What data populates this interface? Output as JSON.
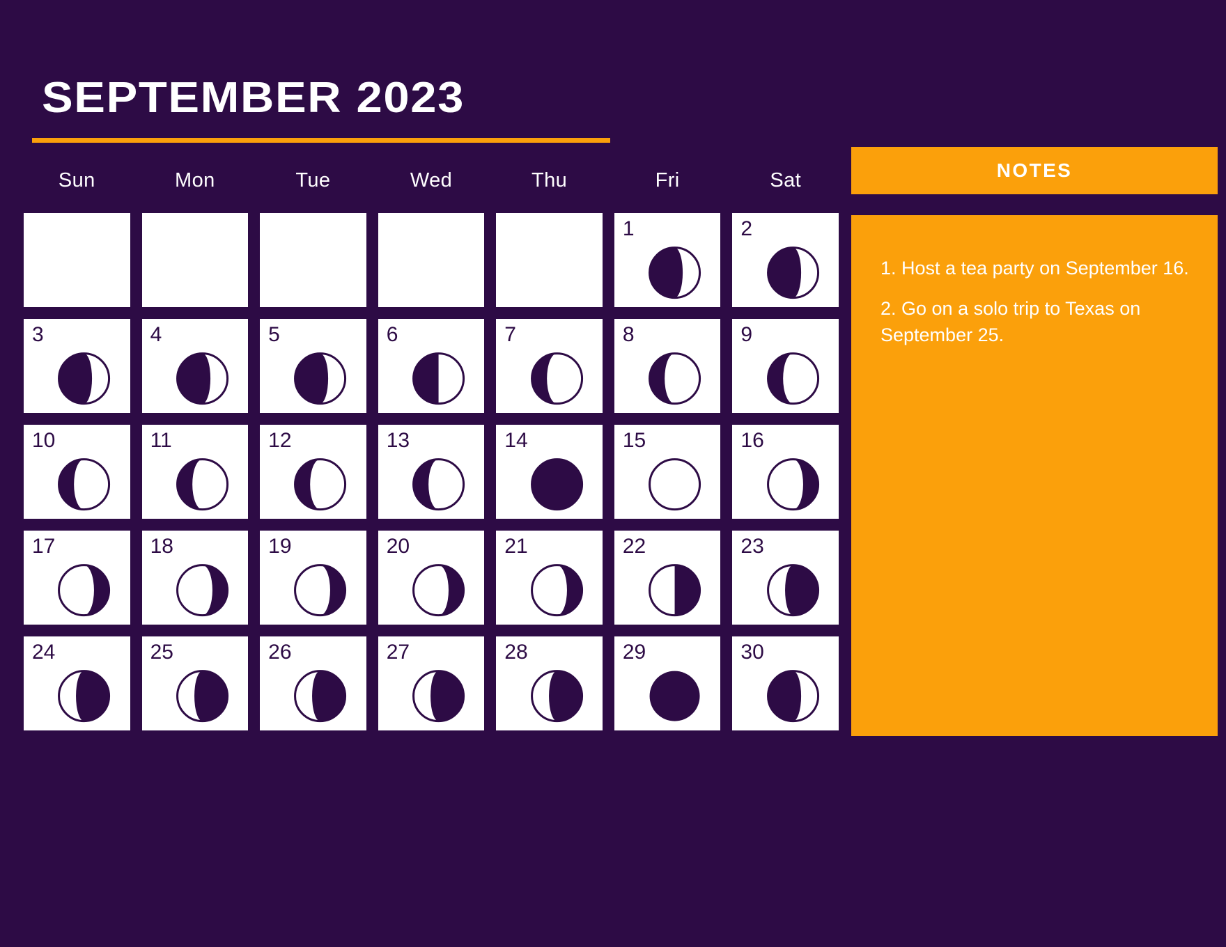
{
  "theme": {
    "background": "#2D0B45",
    "accent": "#FBA00B",
    "cell_bg": "#FFFFFF",
    "ink": "#2D0B45",
    "text_light": "#FFFFFF"
  },
  "header": {
    "title": "SEPTEMBER 2023"
  },
  "calendar": {
    "weekdays": [
      "Sun",
      "Mon",
      "Tue",
      "Wed",
      "Thu",
      "Fri",
      "Sat"
    ],
    "weeks": [
      [
        {
          "day": "",
          "phase": "none"
        },
        {
          "day": "",
          "phase": "none"
        },
        {
          "day": "",
          "phase": "none"
        },
        {
          "day": "",
          "phase": "none"
        },
        {
          "day": "",
          "phase": "none"
        },
        {
          "day": "1",
          "phase": "waning-gibbous"
        },
        {
          "day": "2",
          "phase": "waning-gibbous"
        }
      ],
      [
        {
          "day": "3",
          "phase": "waning-gibbous"
        },
        {
          "day": "4",
          "phase": "waning-gibbous"
        },
        {
          "day": "5",
          "phase": "waning-gibbous"
        },
        {
          "day": "6",
          "phase": "last-quarter"
        },
        {
          "day": "7",
          "phase": "waning-crescent"
        },
        {
          "day": "8",
          "phase": "waning-crescent"
        },
        {
          "day": "9",
          "phase": "waning-crescent"
        }
      ],
      [
        {
          "day": "10",
          "phase": "waning-crescent"
        },
        {
          "day": "11",
          "phase": "waning-crescent"
        },
        {
          "day": "12",
          "phase": "waning-crescent"
        },
        {
          "day": "13",
          "phase": "waning-crescent"
        },
        {
          "day": "14",
          "phase": "new-moon"
        },
        {
          "day": "15",
          "phase": "new-moon-outline"
        },
        {
          "day": "16",
          "phase": "waxing-crescent"
        }
      ],
      [
        {
          "day": "17",
          "phase": "waxing-crescent"
        },
        {
          "day": "18",
          "phase": "waxing-crescent"
        },
        {
          "day": "19",
          "phase": "waxing-crescent"
        },
        {
          "day": "20",
          "phase": "waxing-crescent"
        },
        {
          "day": "21",
          "phase": "waxing-crescent"
        },
        {
          "day": "22",
          "phase": "first-quarter"
        },
        {
          "day": "23",
          "phase": "waxing-gibbous"
        }
      ],
      [
        {
          "day": "24",
          "phase": "waxing-gibbous"
        },
        {
          "day": "25",
          "phase": "waxing-gibbous"
        },
        {
          "day": "26",
          "phase": "waxing-gibbous"
        },
        {
          "day": "27",
          "phase": "waxing-gibbous"
        },
        {
          "day": "28",
          "phase": "waxing-gibbous"
        },
        {
          "day": "29",
          "phase": "full-moon"
        },
        {
          "day": "30",
          "phase": "waning-gibbous"
        }
      ]
    ]
  },
  "notes": {
    "heading": "NOTES",
    "items": [
      "1. Host a tea party on September 16.",
      "2. Go on a solo trip to Texas on September 25."
    ]
  }
}
